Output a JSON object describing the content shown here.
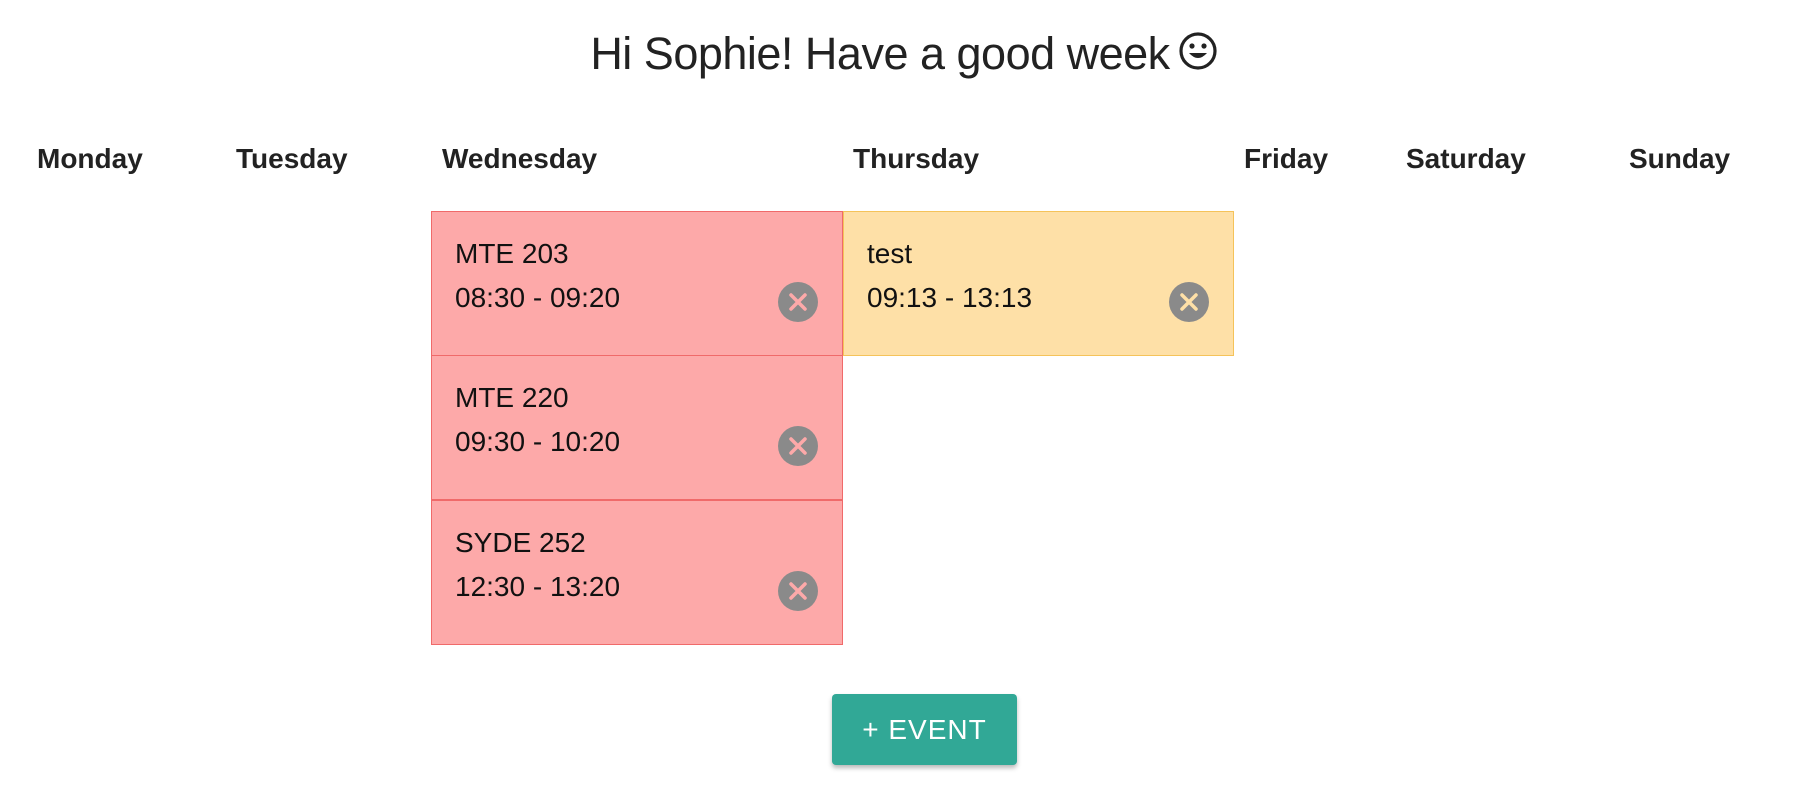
{
  "greeting": "Hi Sophie! Have a good week",
  "greeting_icon": "smiley-face-icon",
  "days": [
    "Monday",
    "Tuesday",
    "Wednesday",
    "Thursday",
    "Friday",
    "Saturday",
    "Sunday"
  ],
  "events": [
    {
      "day": "Wednesday",
      "title": "MTE 203",
      "time": "08:30 - 09:20",
      "color": "#fda9a9",
      "remove_icon": "close-circle-icon"
    },
    {
      "day": "Wednesday",
      "title": "MTE 220",
      "time": "09:30 - 10:20",
      "color": "#fda9a9",
      "remove_icon": "close-circle-icon"
    },
    {
      "day": "Wednesday",
      "title": "SYDE 252",
      "time": "12:30 - 13:20",
      "color": "#fda9a9",
      "remove_icon": "close-circle-icon"
    },
    {
      "day": "Thursday",
      "title": "test",
      "time": "09:13 - 13:13",
      "color": "#fee0a7",
      "remove_icon": "close-circle-icon"
    }
  ],
  "add_event_label": "+ EVENT",
  "colors": {
    "accent": "#31a896",
    "event_red": "#fda9a9",
    "event_yellow": "#fee0a7",
    "remove_button": "#8a8a8a"
  }
}
